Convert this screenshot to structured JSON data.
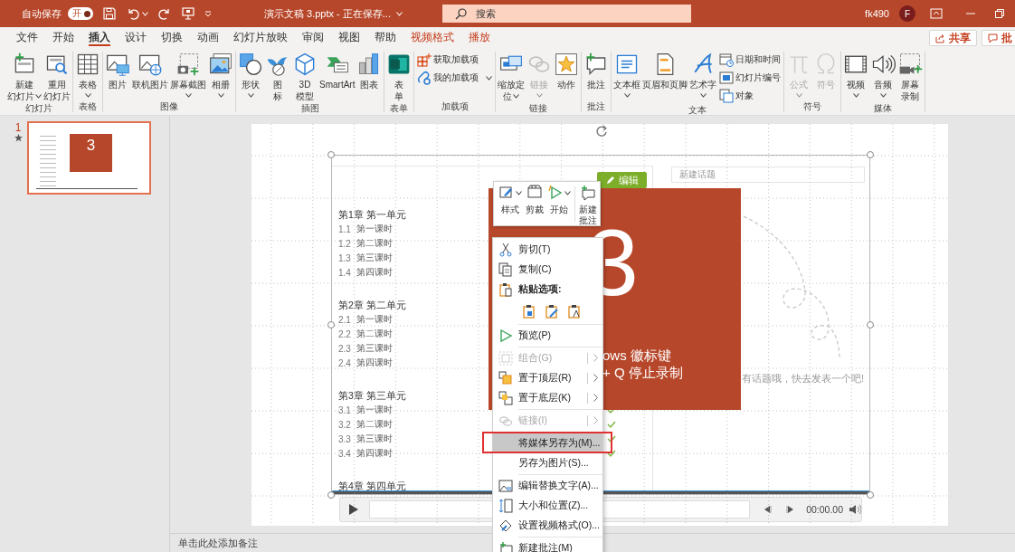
{
  "title_bar": {
    "autosave_label": "自动保存",
    "autosave": {
      "label": "开",
      "on": true
    },
    "document_title": "演示文稿 3.pptx  -  正在保存...",
    "search": {
      "placeholder": "搜索"
    },
    "user_name": "fk490",
    "avatar_initial": "F"
  },
  "tabs": [
    {
      "label": "文件",
      "selected": false,
      "kind": "normal"
    },
    {
      "label": "开始",
      "selected": false,
      "kind": "normal"
    },
    {
      "label": "插入",
      "selected": true,
      "kind": "normal"
    },
    {
      "label": "设计",
      "selected": false,
      "kind": "normal"
    },
    {
      "label": "切换",
      "selected": false,
      "kind": "normal"
    },
    {
      "label": "动画",
      "selected": false,
      "kind": "normal"
    },
    {
      "label": "幻灯片放映",
      "selected": false,
      "kind": "normal"
    },
    {
      "label": "审阅",
      "selected": false,
      "kind": "normal"
    },
    {
      "label": "视图",
      "selected": false,
      "kind": "normal"
    },
    {
      "label": "帮助",
      "selected": false,
      "kind": "normal"
    },
    {
      "label": "视频格式",
      "selected": false,
      "kind": "contextual"
    },
    {
      "label": "播放",
      "selected": false,
      "kind": "contextual"
    }
  ],
  "share_button": "共享",
  "comments_button": "批",
  "ribbon": {
    "groups": [
      {
        "label": "幻灯片",
        "buttons": [
          {
            "lines": [
              "新建",
              "幻灯片"
            ],
            "kind": "large",
            "dropdown": true,
            "disabled": false
          },
          {
            "lines": [
              "重用",
              "幻灯片"
            ],
            "kind": "large",
            "dropdown": false,
            "disabled": false
          }
        ]
      },
      {
        "label": "表格",
        "buttons": [
          {
            "lines": [
              "表格"
            ],
            "kind": "large",
            "dropdown": true,
            "disabled": false
          }
        ]
      },
      {
        "label": "图像",
        "buttons": [
          {
            "lines": [
              "图片"
            ],
            "kind": "large",
            "dropdown": false,
            "disabled": false
          },
          {
            "lines": [
              "联机图片"
            ],
            "kind": "large",
            "dropdown": false,
            "disabled": false
          },
          {
            "lines": [
              "屏幕截图"
            ],
            "kind": "large",
            "dropdown": true,
            "disabled": false
          },
          {
            "lines": [
              "相册"
            ],
            "kind": "large",
            "dropdown": true,
            "disabled": false
          }
        ]
      },
      {
        "label": "插图",
        "buttons": [
          {
            "lines": [
              "形状"
            ],
            "kind": "large",
            "dropdown": true,
            "disabled": false
          },
          {
            "lines": [
              "图",
              "标"
            ],
            "kind": "large",
            "dropdown": false,
            "disabled": false
          },
          {
            "lines": [
              "3D",
              "模型"
            ],
            "kind": "large",
            "dropdown": false,
            "disabled": false
          },
          {
            "lines": [
              "SmartArt"
            ],
            "kind": "large",
            "dropdown": false,
            "disabled": false
          },
          {
            "lines": [
              "图表"
            ],
            "kind": "large",
            "dropdown": false,
            "disabled": false
          }
        ]
      },
      {
        "label": "表单",
        "buttons": [
          {
            "lines": [
              "表",
              "单"
            ],
            "kind": "large",
            "dropdown": false,
            "disabled": false
          }
        ]
      },
      {
        "label": "加载项",
        "buttons": [
          {
            "lines": [
              "获取加载项"
            ],
            "kind": "small",
            "dropdown": false,
            "disabled": false
          },
          {
            "lines": [
              "我的加载项"
            ],
            "kind": "small",
            "dropdown": true,
            "disabled": false
          }
        ]
      },
      {
        "label": "链接",
        "buttons": [
          {
            "lines": [
              "缩放定",
              "位"
            ],
            "kind": "large",
            "dropdown": true,
            "disabled": false
          },
          {
            "lines": [
              "链接"
            ],
            "kind": "large",
            "dropdown": true,
            "disabled": true
          },
          {
            "lines": [
              "动作"
            ],
            "kind": "large",
            "dropdown": false,
            "disabled": false
          }
        ]
      },
      {
        "label": "批注",
        "buttons": [
          {
            "lines": [
              "批注"
            ],
            "kind": "large",
            "dropdown": false,
            "disabled": false
          }
        ]
      },
      {
        "label": "文本",
        "buttons": [
          {
            "lines": [
              "文本框"
            ],
            "kind": "large",
            "dropdown": true,
            "disabled": false
          },
          {
            "lines": [
              "页眉和页脚"
            ],
            "kind": "large",
            "dropdown": false,
            "disabled": false
          },
          {
            "lines": [
              "艺术字"
            ],
            "kind": "large",
            "dropdown": true,
            "disabled": false
          },
          {
            "lines": [
              "日期和时间"
            ],
            "kind": "small",
            "dropdown": false,
            "disabled": false
          },
          {
            "lines": [
              "幻灯片编号"
            ],
            "kind": "small",
            "dropdown": false,
            "disabled": false
          },
          {
            "lines": [
              "对象"
            ],
            "kind": "small",
            "dropdown": false,
            "disabled": false
          }
        ]
      },
      {
        "label": "符号",
        "buttons": [
          {
            "lines": [
              "公式"
            ],
            "kind": "large",
            "dropdown": true,
            "disabled": true
          },
          {
            "lines": [
              "符号"
            ],
            "kind": "large",
            "dropdown": false,
            "disabled": true
          }
        ]
      },
      {
        "label": "媒体",
        "buttons": [
          {
            "lines": [
              "视频"
            ],
            "kind": "large",
            "dropdown": true,
            "disabled": false
          },
          {
            "lines": [
              "音频"
            ],
            "kind": "large",
            "dropdown": true,
            "disabled": false
          },
          {
            "lines": [
              "屏幕",
              "录制"
            ],
            "kind": "large",
            "dropdown": false,
            "disabled": false
          }
        ]
      }
    ]
  },
  "slides_pane": {
    "slides": [
      {
        "number": "1",
        "selected": true,
        "has_animation": true,
        "thumbnail_text": "3"
      }
    ]
  },
  "video": {
    "chapters": [
      {
        "title": "第1章 第一单元",
        "lessons": [
          {
            "number": "1.1",
            "title": "第一课时",
            "completed": false
          },
          {
            "number": "1.2",
            "title": "第二课时",
            "completed": false
          },
          {
            "number": "1.3",
            "title": "第三课时",
            "completed": false
          },
          {
            "number": "1.4",
            "title": "第四课时",
            "completed": false
          }
        ]
      },
      {
        "title": "第2章 第二单元",
        "lessons": [
          {
            "number": "2.1",
            "title": "第一课时",
            "completed": false
          },
          {
            "number": "2.2",
            "title": "第二课时",
            "completed": false
          },
          {
            "number": "2.3",
            "title": "第三课时",
            "completed": false
          },
          {
            "number": "2.4",
            "title": "第四课时",
            "completed": false
          }
        ]
      },
      {
        "title": "第3章 第三单元",
        "lessons": [
          {
            "number": "3.1",
            "title": "第一课时",
            "completed": true
          },
          {
            "number": "3.2",
            "title": "第二课时",
            "completed": true
          },
          {
            "number": "3.3",
            "title": "第三课时",
            "completed": true
          },
          {
            "number": "3.4",
            "title": "第四课时",
            "completed": true
          }
        ]
      },
      {
        "title": "第4章 第四单元"
      }
    ],
    "edit_button": "编辑",
    "topic_field": {
      "placeholder": "新建话题"
    },
    "empty_message": "有话题哦，快去发表一个吧!",
    "recording_card": {
      "number": "3",
      "lines": [
        "ows 徽标键",
        "+ Q 停止录制"
      ]
    },
    "player": {
      "time": "00:00.00"
    }
  },
  "mini_toolbar": {
    "buttons": [
      {
        "lines": [
          "样式"
        ],
        "dropdown": true
      },
      {
        "lines": [
          "剪裁"
        ],
        "dropdown": false
      },
      {
        "lines": [
          "开始"
        ],
        "dropdown": true
      },
      {
        "lines": [
          "新建",
          "批注"
        ],
        "dropdown": false
      }
    ]
  },
  "context_menu": {
    "items": [
      {
        "kind": "command",
        "label": "剪切(T)",
        "disabled": false,
        "submenu": false,
        "hovered": false,
        "annotated": false,
        "divider_above": false
      },
      {
        "kind": "command",
        "label": "复制(C)",
        "disabled": false,
        "submenu": false,
        "hovered": false,
        "annotated": false,
        "divider_above": false
      },
      {
        "kind": "header",
        "label": "粘贴选项:"
      },
      {
        "kind": "paste_options"
      },
      {
        "kind": "command",
        "label": "预览(P)",
        "disabled": false,
        "submenu": false,
        "hovered": false,
        "annotated": false,
        "divider_above": true
      },
      {
        "kind": "command",
        "label": "组合(G)",
        "disabled": true,
        "submenu": true,
        "hovered": false,
        "annotated": false,
        "divider_above": true
      },
      {
        "kind": "command",
        "label": "置于顶层(R)",
        "disabled": false,
        "submenu": true,
        "hovered": false,
        "annotated": false,
        "divider_above": false
      },
      {
        "kind": "command",
        "label": "置于底层(K)",
        "disabled": false,
        "submenu": true,
        "hovered": false,
        "annotated": false,
        "divider_above": false
      },
      {
        "kind": "command",
        "label": "链接(I)",
        "disabled": true,
        "submenu": true,
        "hovered": false,
        "annotated": false,
        "divider_above": true
      },
      {
        "kind": "command",
        "label": "将媒体另存为(M)...",
        "disabled": false,
        "submenu": false,
        "hovered": true,
        "annotated": true,
        "divider_above": true
      },
      {
        "kind": "command",
        "label": "另存为图片(S)...",
        "disabled": false,
        "submenu": false,
        "hovered": false,
        "annotated": false,
        "divider_above": false
      },
      {
        "kind": "command",
        "label": "编辑替换文字(A)...",
        "disabled": false,
        "submenu": false,
        "hovered": false,
        "annotated": false,
        "divider_above": true
      },
      {
        "kind": "command",
        "label": "大小和位置(Z)...",
        "disabled": false,
        "submenu": false,
        "hovered": false,
        "annotated": false,
        "divider_above": false
      },
      {
        "kind": "command",
        "label": "设置视频格式(O)...",
        "disabled": false,
        "submenu": false,
        "hovered": false,
        "annotated": false,
        "divider_above": false
      },
      {
        "kind": "command",
        "label": "新建批注(M)",
        "disabled": false,
        "submenu": false,
        "hovered": false,
        "annotated": false,
        "divider_above": true
      }
    ]
  },
  "notes": {
    "placeholder": "单击此处添加备注"
  }
}
